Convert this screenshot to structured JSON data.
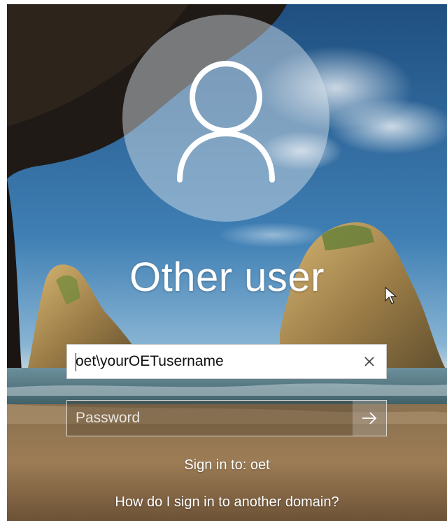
{
  "login": {
    "title": "Other user",
    "username": {
      "value": "oet\\yourOETusername"
    },
    "password": {
      "placeholder": "Password",
      "value": ""
    },
    "sign_in_to": "Sign in to: oet",
    "other_domain_link": "How do I sign in to another domain?"
  },
  "icons": {
    "avatar": "user-silhouette-icon",
    "clear": "close-icon",
    "submit": "arrow-right-icon",
    "cursor": "mouse-pointer-icon"
  },
  "colors": {
    "sky": "#2a5e8c",
    "input_background": "#ffffff",
    "text": "#ffffff"
  }
}
